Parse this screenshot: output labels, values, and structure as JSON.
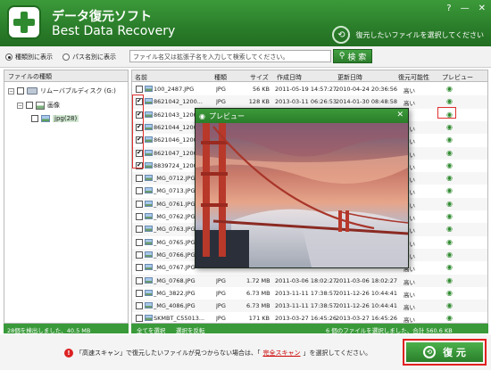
{
  "app": {
    "title_ja": "データ復元ソフト",
    "title_en": "Best Data Recovery",
    "header_hint": "復元したいファイルを選択してください",
    "window_buttons": [
      "?",
      "—",
      "✕"
    ]
  },
  "toolbar": {
    "view_by_type": "種類別に表示",
    "view_by_path": "パス名別に表示",
    "search_placeholder": "ファイル名又は拡張子名を入力して検索してください。",
    "search_button": "検 索"
  },
  "tree": {
    "header": "ファイルの種類",
    "drive": "リムーバブルディスク (G:)",
    "images": "画像",
    "jpg": "jpg(28)"
  },
  "list": {
    "columns": [
      "名前",
      "種類",
      "サイズ",
      "作成日時",
      "更新日時",
      "復元可能性",
      "プレビュー"
    ],
    "rows": [
      {
        "name": "100_2487.JPG",
        "type": "JPG",
        "size": "56 KB",
        "created": "2011-05-19 14:57:27",
        "modified": "2010-04-24 20:36:56",
        "rec": "高い",
        "checked": false
      },
      {
        "name": "8621042_1200...",
        "type": "JPG",
        "size": "128 KB",
        "created": "2013-03-11 06:26:53",
        "modified": "2014-01-30 08:48:58",
        "rec": "高い",
        "checked": true
      },
      {
        "name": "8621043_1200...",
        "type": "",
        "size": "",
        "created": "",
        "modified": "",
        "rec": "",
        "checked": true
      },
      {
        "name": "8621044_1200...",
        "type": "",
        "size": "",
        "created": "",
        "modified": "",
        "rec": "高い",
        "checked": true
      },
      {
        "name": "8621046_1200...",
        "type": "",
        "size": "",
        "created": "",
        "modified": "",
        "rec": "高い",
        "checked": true
      },
      {
        "name": "8621047_1200...",
        "type": "",
        "size": "",
        "created": "",
        "modified": "",
        "rec": "高い",
        "checked": true
      },
      {
        "name": "8839724_1200...",
        "type": "",
        "size": "",
        "created": "",
        "modified": "",
        "rec": "高い",
        "checked": true
      },
      {
        "name": "_MG_0712.JPG",
        "type": "",
        "size": "",
        "created": "",
        "modified": "",
        "rec": "高い",
        "checked": false
      },
      {
        "name": "_MG_0713.JPG",
        "type": "",
        "size": "",
        "created": "",
        "modified": "",
        "rec": "高い",
        "checked": false
      },
      {
        "name": "_MG_0761.JPG",
        "type": "",
        "size": "",
        "created": "",
        "modified": "",
        "rec": "高い",
        "checked": false
      },
      {
        "name": "_MG_0762.JPG",
        "type": "",
        "size": "",
        "created": "",
        "modified": "",
        "rec": "高い",
        "checked": false
      },
      {
        "name": "_MG_0763.JPG",
        "type": "",
        "size": "",
        "created": "",
        "modified": "",
        "rec": "高い",
        "checked": false
      },
      {
        "name": "_MG_0765.JPG",
        "type": "",
        "size": "",
        "created": "",
        "modified": "",
        "rec": "高い",
        "checked": false
      },
      {
        "name": "_MG_0766.JPG",
        "type": "",
        "size": "",
        "created": "",
        "modified": "",
        "rec": "高い",
        "checked": false
      },
      {
        "name": "_MG_0767.JPG",
        "type": "",
        "size": "",
        "created": "",
        "modified": "",
        "rec": "高い",
        "checked": false
      },
      {
        "name": "_MG_0768.JPG",
        "type": "JPG",
        "size": "1.72 MB",
        "created": "2011-03-06 18:02:27",
        "modified": "2011-03-06 18:02:27",
        "rec": "高い",
        "checked": false
      },
      {
        "name": "_MG_3822.JPG",
        "type": "JPG",
        "size": "6.73 MB",
        "created": "2013-11-11 17:38:57",
        "modified": "2011-12-26 10:44:41",
        "rec": "高い",
        "checked": false
      },
      {
        "name": "_MG_4086.JPG",
        "type": "JPG",
        "size": "6.73 MB",
        "created": "2013-11-11 17:38:57",
        "modified": "2011-12-26 10:44:41",
        "rec": "高い",
        "checked": false
      },
      {
        "name": "SKMBT_C55013...",
        "type": "JPG",
        "size": "171 KB",
        "created": "2013-03-27 16:45:26",
        "modified": "2013-03-27 16:45:26",
        "rec": "高い",
        "checked": false
      }
    ]
  },
  "status": {
    "left": "28個を検出しました、40.5 MB",
    "select_all": "全てを選択",
    "invert": "選択を反転",
    "right": "6 個のファイルを選択しました、合計 560.6 KB"
  },
  "preview": {
    "title": "プレビュー",
    "close": "✕"
  },
  "bottom": {
    "notice_pre": "「高速スキャン」で復元したいファイルが見つからない場合は、「",
    "notice_link": "完全スキャン",
    "notice_post": "」を選択してください。",
    "recover_button": "復 元"
  }
}
